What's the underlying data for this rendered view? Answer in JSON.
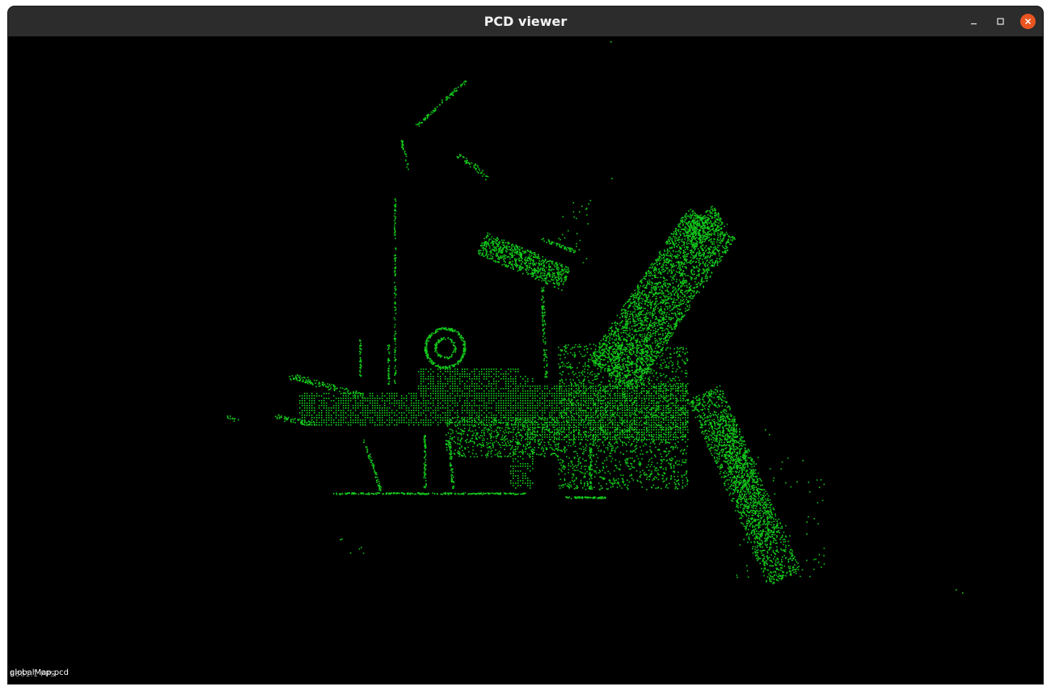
{
  "window": {
    "title": "PCD viewer",
    "controls": {
      "minimize": "minimize-icon",
      "maximize": "maximize-icon",
      "close": "close-icon"
    },
    "colors": {
      "titlebar": "#2c2c2c",
      "close_button": "#e95420",
      "background": "#000000"
    }
  },
  "viewer": {
    "point_color": "#12c81a",
    "background": "#000000",
    "fps_text": "6861.1 FPS",
    "cloud_name": "globalMap.pcd"
  }
}
